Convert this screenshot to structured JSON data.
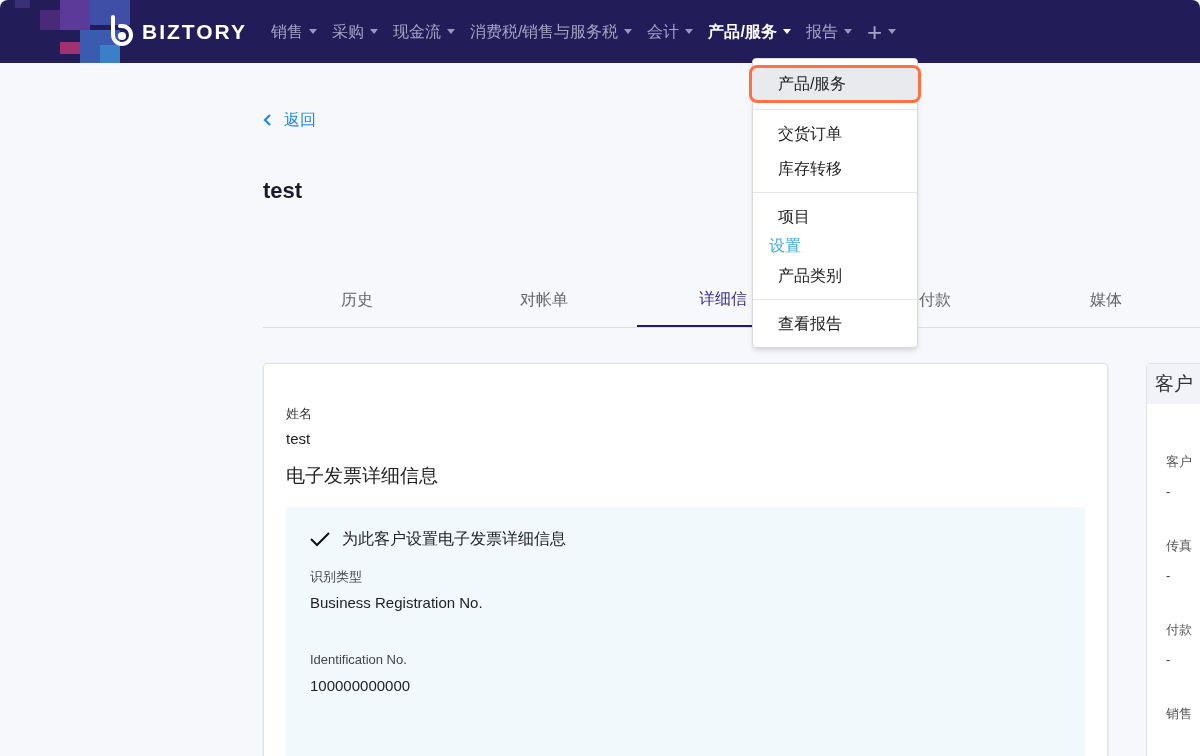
{
  "nav": {
    "logo": "BIZTORY",
    "items": [
      {
        "label": "销售",
        "selected": false
      },
      {
        "label": "采购",
        "selected": false
      },
      {
        "label": "现金流",
        "selected": false
      },
      {
        "label": "消费税/销售与服务税",
        "selected": false
      },
      {
        "label": "会计",
        "selected": false
      },
      {
        "label": "产品/服务",
        "selected": true
      },
      {
        "label": "报告",
        "selected": false
      },
      {
        "label": "+",
        "selected": false
      }
    ]
  },
  "dropdown": {
    "groups": [
      {
        "items": [
          {
            "kind": "item",
            "label": "产品/服务",
            "selected": true
          }
        ]
      },
      {
        "items": [
          {
            "kind": "item",
            "label": "交货订单",
            "selected": false
          },
          {
            "kind": "item",
            "label": "库存转移",
            "selected": false
          }
        ]
      },
      {
        "items": [
          {
            "kind": "item",
            "label": "项目",
            "selected": false
          },
          {
            "kind": "header",
            "label": "设置"
          },
          {
            "kind": "item",
            "label": "产品类别",
            "selected": false
          }
        ]
      },
      {
        "items": [
          {
            "kind": "item",
            "label": "查看报告",
            "selected": false
          }
        ]
      }
    ]
  },
  "back": "返回",
  "title": "test",
  "tabs": [
    {
      "label": "历史",
      "selected": false
    },
    {
      "label": "对帐单",
      "selected": false
    },
    {
      "label": "详细信",
      "selected": true
    },
    {
      "label": "付款",
      "selected": false
    },
    {
      "label": "媒体",
      "selected": false
    }
  ],
  "details": {
    "name_label": "姓名",
    "name_value": "test",
    "section_title": "电子发票详细信息",
    "einvoice": {
      "checked": true,
      "check_label": "为此客户设置电子发票详细信息",
      "fields": [
        {
          "label": "识别类型",
          "value": "Business Registration No."
        },
        {
          "label": "Identification No.",
          "value": "100000000000"
        }
      ]
    }
  },
  "side_card": {
    "title": "客户",
    "fields": [
      {
        "label": "客户",
        "value": "-"
      },
      {
        "label": "传真",
        "value": "-"
      },
      {
        "label": "付款",
        "value": "-"
      },
      {
        "label": "销售"
      }
    ]
  }
}
